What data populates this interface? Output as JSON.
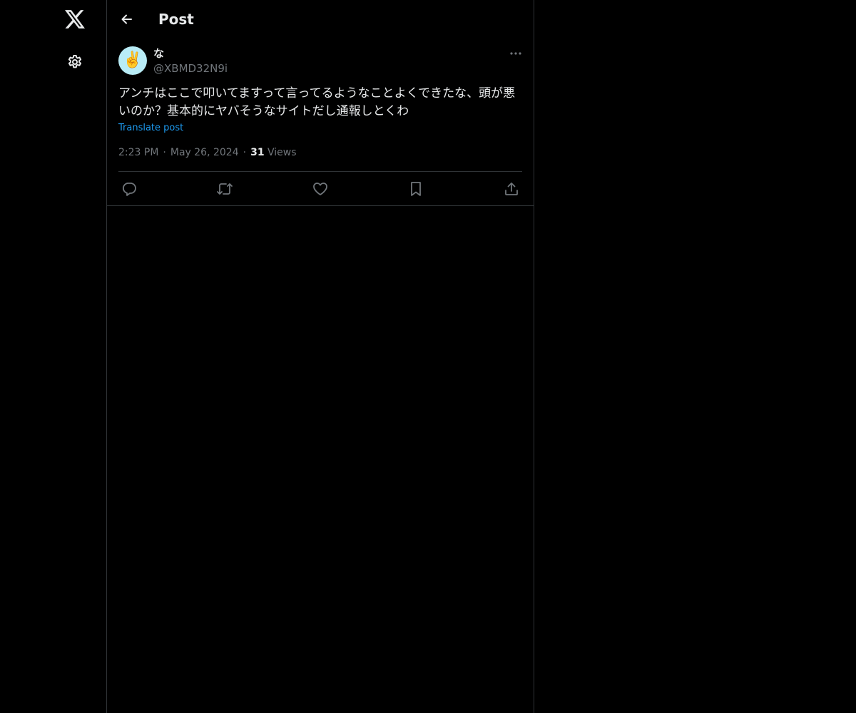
{
  "nav": {
    "logo_icon": "x-logo-icon",
    "settings_icon": "gear-icon"
  },
  "header": {
    "title": "Post",
    "back_icon": "arrow-left-icon"
  },
  "post": {
    "author": {
      "display_name": "な",
      "handle": "@XBMD32N9i",
      "avatar_glyph": "✌️",
      "avatar_bg": "#b8ecf6"
    },
    "text": "アンチはここで叩いてますって言ってるようなことよくできたな、頭が悪いのか？基本的にヤバそうなサイトだし通報しとくわ",
    "translate_label": "Translate post",
    "time": "2:23 PM",
    "separator": "·",
    "date": "May 26, 2024",
    "views_count": "31",
    "views_label": "Views",
    "more_icon": "more-horizontal-icon"
  },
  "actions": [
    {
      "name": "reply",
      "icon": "reply-icon"
    },
    {
      "name": "repost",
      "icon": "repost-icon"
    },
    {
      "name": "like",
      "icon": "heart-icon"
    },
    {
      "name": "bookmark",
      "icon": "bookmark-icon"
    },
    {
      "name": "share",
      "icon": "share-icon"
    }
  ],
  "colors": {
    "background": "#000000",
    "border": "#2f3336",
    "text_primary": "#e7e9ea",
    "text_secondary": "#71767b",
    "accent": "#1d9bf0"
  }
}
